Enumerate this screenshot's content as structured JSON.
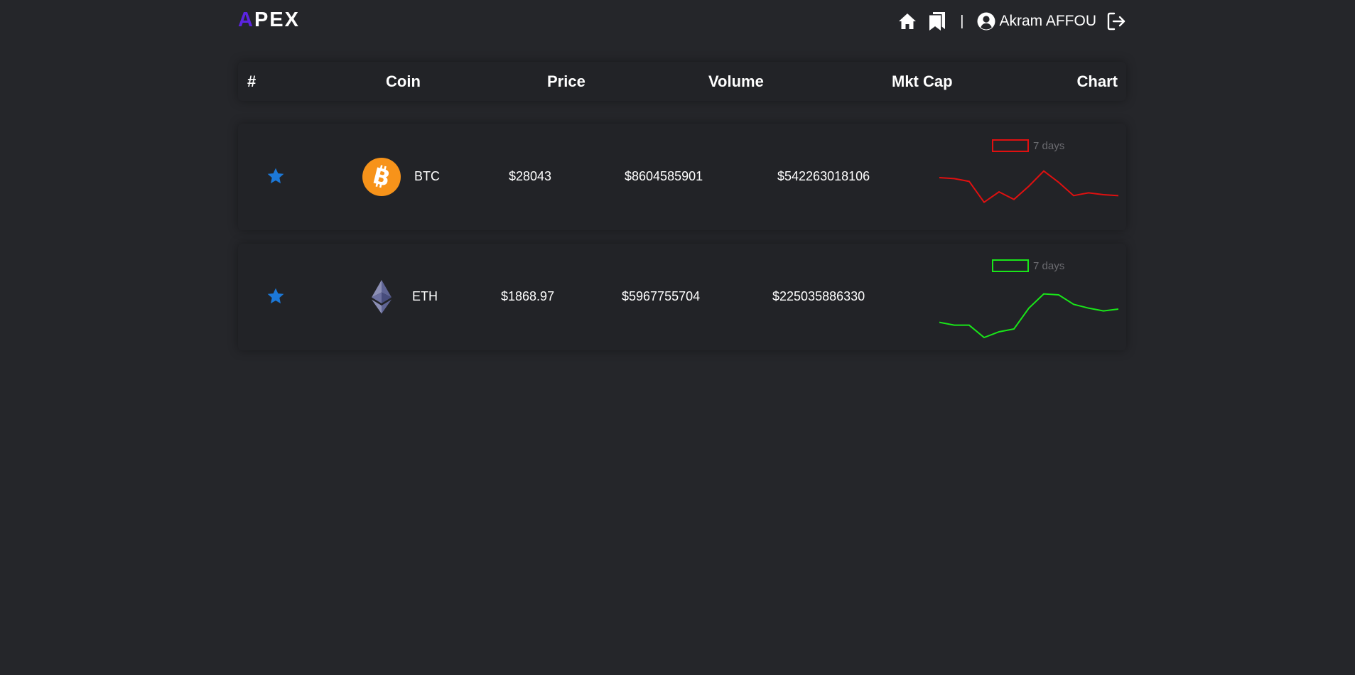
{
  "header": {
    "logo_first": "A",
    "logo_rest": "PEX",
    "separator": "|",
    "user_name": "Akram AFFOU"
  },
  "table": {
    "columns": [
      "#",
      "Coin",
      "Price",
      "Volume",
      "Mkt Cap",
      "Chart"
    ],
    "rows": [
      {
        "symbol": "BTC",
        "price": "$28043",
        "volume": "$8604585901",
        "mkt_cap": "$542263018106",
        "chart_label": "7 days",
        "chart_color": "#e01010"
      },
      {
        "symbol": "ETH",
        "price": "$1868.97",
        "volume": "$5967755704",
        "mkt_cap": "$225035886330",
        "chart_label": "7 days",
        "chart_color": "#19e619"
      }
    ]
  },
  "chart_data": [
    {
      "type": "line",
      "series": [
        {
          "values": [
            68,
            67,
            64,
            42,
            53,
            45,
            59,
            75,
            63,
            49,
            52,
            50,
            49
          ]
        }
      ]
    },
    {
      "type": "line",
      "series": [
        {
          "values": [
            42,
            39,
            39,
            26,
            32,
            35,
            57,
            72,
            71,
            61,
            57,
            54,
            56
          ]
        }
      ]
    }
  ],
  "colors": {
    "background": "#25262a",
    "card": "#222327",
    "accent_logo": "#5b23e0",
    "star": "#1c78d8",
    "btc_orange": "#f7931a"
  },
  "icons": [
    "home-icon",
    "bookmarks-icon",
    "user-circle-icon",
    "logout-icon",
    "star-icon",
    "bitcoin-icon",
    "ethereum-icon"
  ]
}
